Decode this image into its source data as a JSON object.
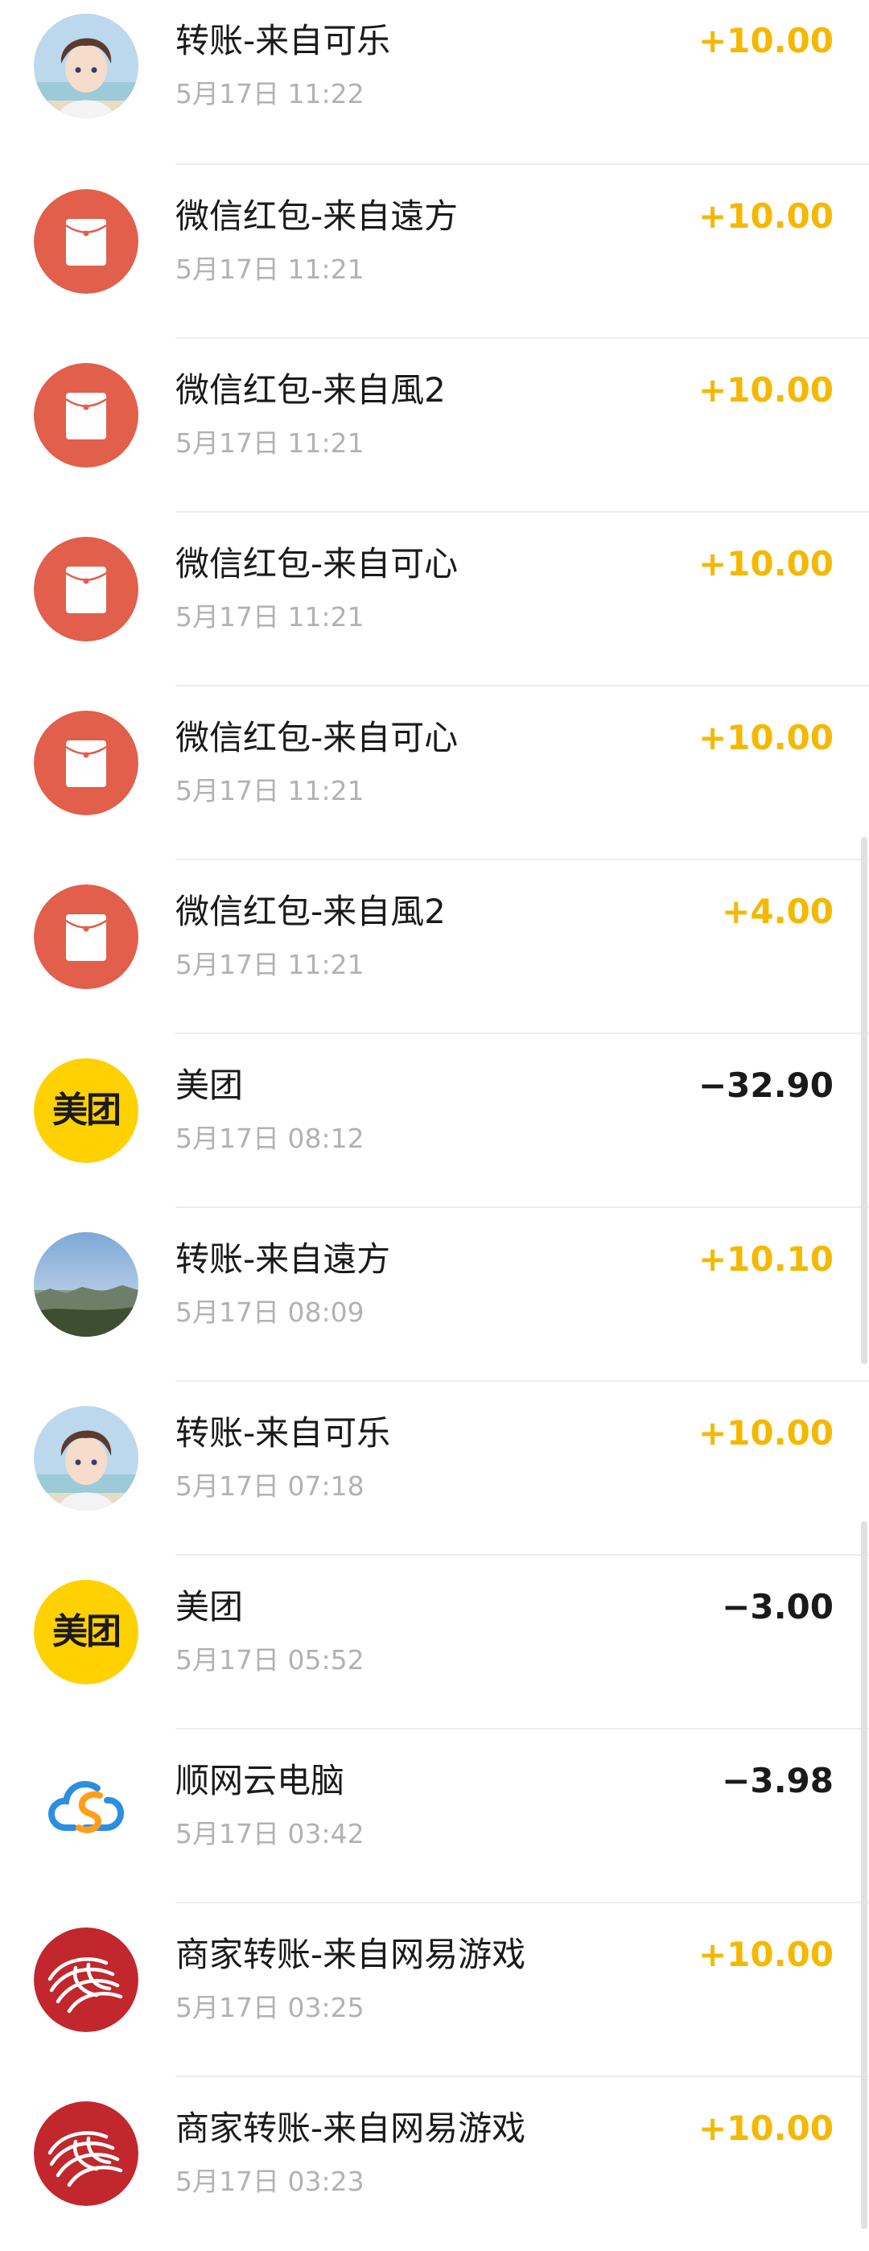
{
  "transactions": [
    {
      "icon": "avatar-boy-icon",
      "title": "转账-来自可乐",
      "time": "5月17日 11:22",
      "amount": "+10.00",
      "type": "income"
    },
    {
      "icon": "red-packet-icon",
      "title": "微信红包-来自遠方",
      "time": "5月17日 11:21",
      "amount": "+10.00",
      "type": "income"
    },
    {
      "icon": "red-packet-icon",
      "title": "微信红包-来自風2",
      "time": "5月17日 11:21",
      "amount": "+10.00",
      "type": "income"
    },
    {
      "icon": "red-packet-icon",
      "title": "微信红包-来自可心",
      "time": "5月17日 11:21",
      "amount": "+10.00",
      "type": "income"
    },
    {
      "icon": "red-packet-icon",
      "title": "微信红包-来自可心",
      "time": "5月17日 11:21",
      "amount": "+10.00",
      "type": "income"
    },
    {
      "icon": "red-packet-icon",
      "title": "微信红包-来自風2",
      "time": "5月17日 11:21",
      "amount": "+4.00",
      "type": "income"
    },
    {
      "icon": "meituan-logo-icon",
      "logo_text": "美团",
      "title": "美团",
      "time": "5月17日 08:12",
      "amount": "−32.90",
      "type": "expense"
    },
    {
      "icon": "avatar-landscape-icon",
      "title": "转账-来自遠方",
      "time": "5月17日 08:09",
      "amount": "+10.10",
      "type": "income"
    },
    {
      "icon": "avatar-boy-icon",
      "title": "转账-来自可乐",
      "time": "5月17日 07:18",
      "amount": "+10.00",
      "type": "income"
    },
    {
      "icon": "meituan-logo-icon",
      "logo_text": "美团",
      "title": "美团",
      "time": "5月17日 05:52",
      "amount": "−3.00",
      "type": "expense"
    },
    {
      "icon": "cloud-logo-icon",
      "title": "顺网云电脑",
      "time": "5月17日 03:42",
      "amount": "−3.98",
      "type": "expense"
    },
    {
      "icon": "netease-logo-icon",
      "title": "商家转账-来自网易游戏",
      "time": "5月17日 03:25",
      "amount": "+10.00",
      "type": "income"
    },
    {
      "icon": "netease-logo-icon",
      "title": "商家转账-来自网易游戏",
      "time": "5月17日 03:23",
      "amount": "+10.00",
      "type": "income"
    }
  ],
  "colors": {
    "income": "#f5b800",
    "expense": "#1a1a1a",
    "red_packet_bg": "#e15f4b",
    "meituan_yellow": "#ffd100",
    "netease_red": "#c1272d"
  }
}
